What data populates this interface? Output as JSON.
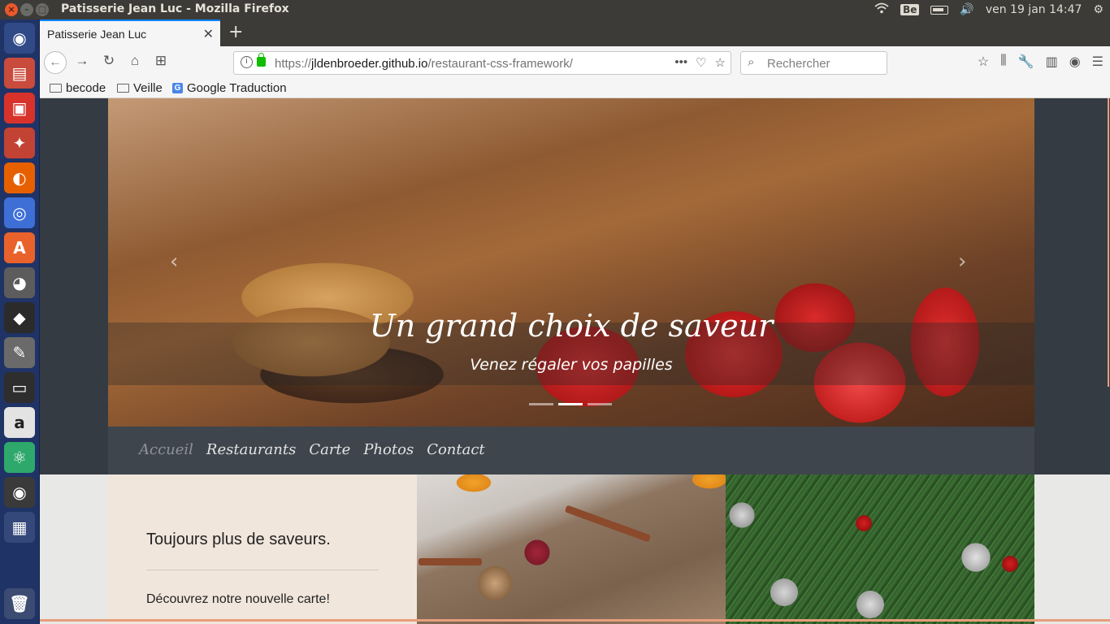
{
  "os": {
    "window_title": "Patisserie Jean Luc - Mozilla Firefox",
    "keyboard_layout": "Be",
    "clock": "ven 19 jan 14:47"
  },
  "browser": {
    "tab_title": "Patisserie Jean Luc",
    "url_scheme": "https://",
    "url_domain": "jldenbroeder.github.io",
    "url_path": "/restaurant-css-framework/",
    "search_placeholder": "Rechercher",
    "bookmarks": [
      "becode",
      "Veille",
      "Google Traduction"
    ]
  },
  "page": {
    "carousel": {
      "title": "Un grand choix de saveur",
      "subtitle": "Venez régaler vos papilles",
      "slide_count": 3,
      "active_slide": 2
    },
    "nav": {
      "items": [
        "Accueil",
        "Restaurants",
        "Carte",
        "Photos",
        "Contact"
      ],
      "active": "Accueil"
    },
    "feature": {
      "heading": "Toujours plus de saveurs.",
      "text": "Découvrez notre nouvelle carte!"
    }
  },
  "colors": {
    "accent_tab": "#0a84ff",
    "nav_bg": "#3e454d",
    "card_bg": "#f1e6dc",
    "launcher_bg": "#1f3366"
  }
}
